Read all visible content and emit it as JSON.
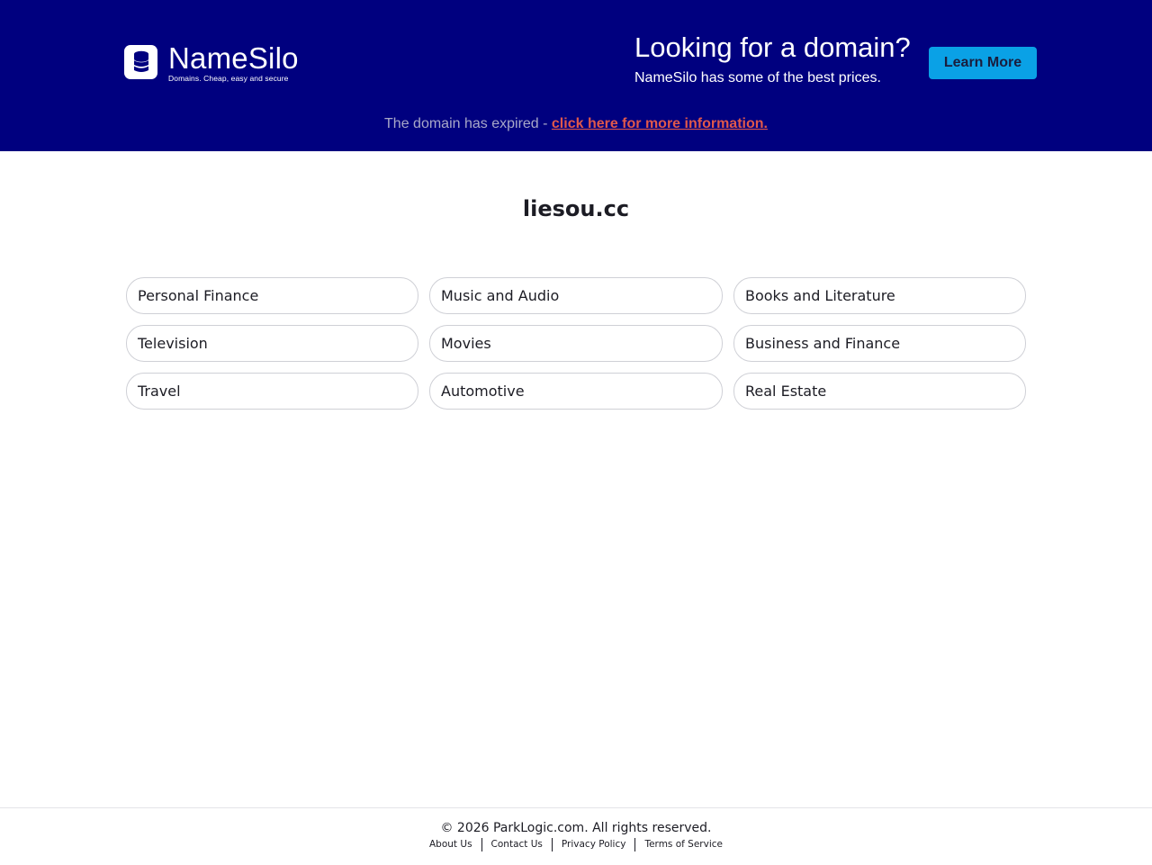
{
  "brand": {
    "name": "NameSilo",
    "tagline": "Domains. Cheap, easy and secure"
  },
  "promo": {
    "title": "Looking for a domain?",
    "subtitle": "NameSilo has some of the best prices.",
    "button_label": "Learn More"
  },
  "notice": {
    "text": "The domain has expired - ",
    "link_text": "click here for more information."
  },
  "domain": "liesou.cc",
  "links": [
    "Personal Finance",
    "Music and Audio",
    "Books and Literature",
    "Television",
    "Movies",
    "Business and Finance",
    "Travel",
    "Automotive",
    "Real Estate"
  ],
  "footer": {
    "copyright": "© 2026 ParkLogic.com. All rights reserved.",
    "links": [
      "About Us",
      "Contact Us",
      "Privacy Policy",
      "Terms of Service"
    ]
  },
  "colors": {
    "banner_bg": "#00007f",
    "button_bg": "#0aa1e6",
    "link_red": "#e0584b"
  },
  "icons": {
    "logo": "database-stack-icon"
  }
}
